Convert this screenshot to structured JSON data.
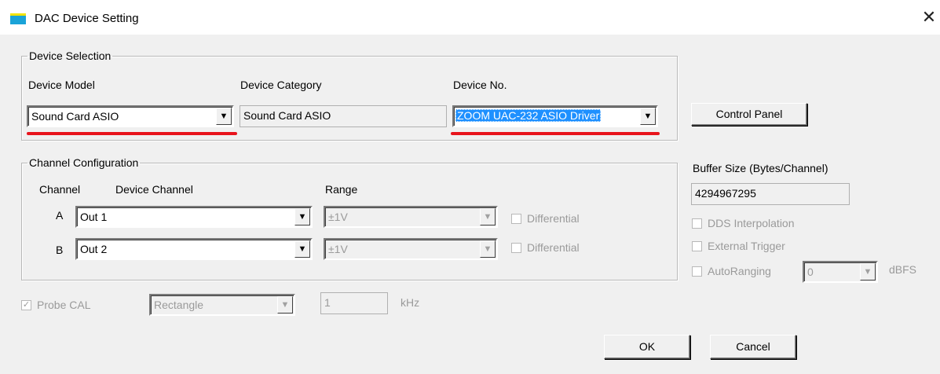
{
  "window": {
    "title": "DAC Device Setting",
    "close_glyph": "✕"
  },
  "device_selection": {
    "legend": "Device Selection",
    "model_label": "Device Model",
    "category_label": "Device Category",
    "number_label": "Device No.",
    "model_value": "Sound Card ASIO",
    "category_value": "Sound Card ASIO",
    "number_value": "ZOOM UAC-232 ASIO Driver"
  },
  "control_panel_label": "Control Panel",
  "channel_config": {
    "legend": "Channel Configuration",
    "col_channel": "Channel",
    "col_device_channel": "Device Channel",
    "col_range": "Range",
    "rows": [
      {
        "channel": "A",
        "device_channel": "Out 1",
        "range": "±1V",
        "differential_label": "Differential",
        "differential_checked": false
      },
      {
        "channel": "B",
        "device_channel": "Out 2",
        "range": "±1V",
        "differential_label": "Differential",
        "differential_checked": false
      }
    ]
  },
  "buffer": {
    "label": "Buffer Size (Bytes/Channel)",
    "value": "4294967295"
  },
  "options": {
    "dds_label": "DDS Interpolation",
    "ext_trigger_label": "External Trigger",
    "autoranging_label": "AutoRanging",
    "autoranging_value": "0",
    "autoranging_unit": "dBFS"
  },
  "probe": {
    "label": "Probe CAL",
    "checked_glyph": "✓",
    "waveform": "Rectangle",
    "frequency": "1",
    "unit": "kHz"
  },
  "buttons": {
    "ok": "OK",
    "cancel": "Cancel"
  },
  "icons": {
    "dropdown": "▼"
  },
  "colors": {
    "selection": "#1e90ff",
    "annotation": "#e8141c"
  }
}
